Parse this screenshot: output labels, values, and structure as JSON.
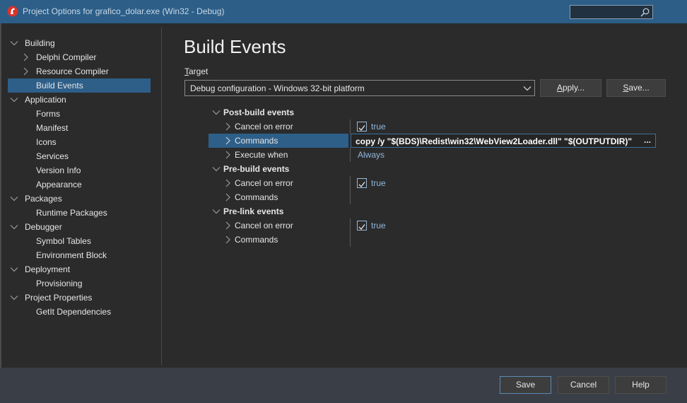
{
  "window": {
    "title": "Project Options for grafico_dolar.exe  (Win32 - Debug)",
    "search_placeholder": ""
  },
  "sidebar": {
    "items": [
      {
        "label": "Building",
        "level": 0,
        "expandable": "expanded"
      },
      {
        "label": "Delphi Compiler",
        "level": 1,
        "expandable": "collapsed"
      },
      {
        "label": "Resource Compiler",
        "level": 1,
        "expandable": "collapsed"
      },
      {
        "label": "Build Events",
        "level": 1,
        "expandable": "none",
        "selected": true
      },
      {
        "label": "Application",
        "level": 0,
        "expandable": "expanded"
      },
      {
        "label": "Forms",
        "level": 1,
        "expandable": "none"
      },
      {
        "label": "Manifest",
        "level": 1,
        "expandable": "none"
      },
      {
        "label": "Icons",
        "level": 1,
        "expandable": "none"
      },
      {
        "label": "Services",
        "level": 1,
        "expandable": "none"
      },
      {
        "label": "Version Info",
        "level": 1,
        "expandable": "none"
      },
      {
        "label": "Appearance",
        "level": 1,
        "expandable": "none"
      },
      {
        "label": "Packages",
        "level": 0,
        "expandable": "expanded"
      },
      {
        "label": "Runtime Packages",
        "level": 1,
        "expandable": "none"
      },
      {
        "label": "Debugger",
        "level": 0,
        "expandable": "expanded"
      },
      {
        "label": "Symbol Tables",
        "level": 1,
        "expandable": "none"
      },
      {
        "label": "Environment Block",
        "level": 1,
        "expandable": "none"
      },
      {
        "label": "Deployment",
        "level": 0,
        "expandable": "expanded"
      },
      {
        "label": "Provisioning",
        "level": 1,
        "expandable": "none"
      },
      {
        "label": "Project Properties",
        "level": 0,
        "expandable": "expanded"
      },
      {
        "label": "GetIt Dependencies",
        "level": 1,
        "expandable": "none"
      }
    ]
  },
  "main": {
    "page_title": "Build Events",
    "target_label_accel": "T",
    "target_label_rest": "arget",
    "target_value": "Debug configuration - Windows 32-bit platform",
    "apply_accel": "A",
    "apply_rest": "pply...",
    "save_accel": "S",
    "save_rest": "ave...",
    "properties": {
      "post_build": {
        "label": "Post-build events",
        "cancel_on_error": "Cancel on error",
        "cancel_value": "true",
        "commands": "Commands",
        "commands_value": "copy /y \"$(BDS)\\Redist\\win32\\WebView2Loader.dll\" \"$(OUTPUTDIR)\"",
        "ellipsis": "...",
        "execute_when": "Execute when",
        "execute_value": "Always"
      },
      "pre_build": {
        "label": "Pre-build events",
        "cancel_on_error": "Cancel on error",
        "cancel_value": "true",
        "commands": "Commands"
      },
      "pre_link": {
        "label": "Pre-link events",
        "cancel_on_error": "Cancel on error",
        "cancel_value": "true",
        "commands": "Commands"
      }
    }
  },
  "footer": {
    "save": "Save",
    "cancel": "Cancel",
    "help": "Help"
  },
  "colors": {
    "titlebar": "#2c5e88",
    "selection": "#2e5f89",
    "value_text": "#8fb7dc",
    "background": "#2b2b2b"
  }
}
